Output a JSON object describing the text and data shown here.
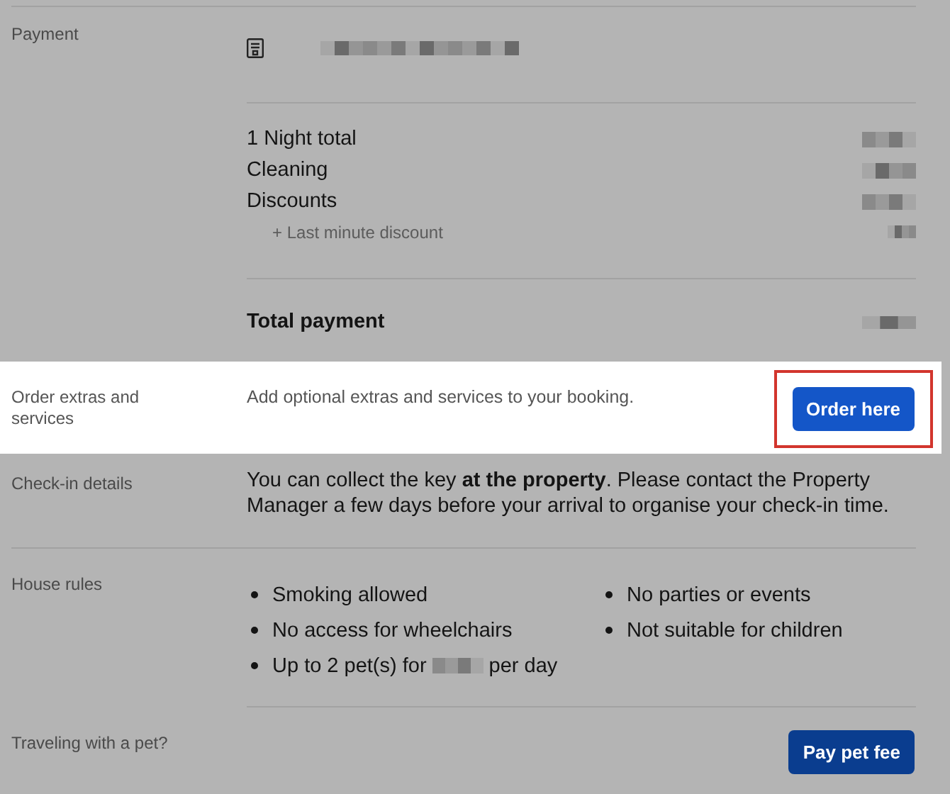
{
  "sections": [
    {
      "kind": "payment",
      "label": "Payment",
      "lines": [
        {
          "label": "1 Night total",
          "sub": false
        },
        {
          "label": "Cleaning",
          "sub": false
        },
        {
          "label": "Discounts",
          "sub": false
        },
        {
          "label": "+ Last minute discount",
          "sub": true
        }
      ],
      "total": "Total payment",
      "highlighted": false
    },
    {
      "kind": "action",
      "label": "Order extras and services",
      "text": "Add optional extras and services to your booking.",
      "button": "Order here",
      "highlighted": true
    },
    {
      "kind": "text",
      "label": "Check-in details",
      "text": "You can collect the key **at the property**. Please contact the Property Manager a few days before your arrival to organise your check-in time.",
      "highlighted": false
    },
    {
      "kind": "rules",
      "label": "House rules",
      "columns": [
        [
          {
            "text": "Smoking allowed"
          },
          {
            "text": "No access for wheelchairs"
          },
          {
            "text": "Up to 2 pet(s) for",
            "after": "per day"
          }
        ],
        [
          {
            "text": "No parties or events"
          },
          {
            "text": "Not suitable for children"
          }
        ]
      ],
      "highlighted": false
    },
    {
      "kind": "action",
      "label": "Traveling with a pet?",
      "button": "Pay pet fee",
      "highlighted": false
    }
  ]
}
